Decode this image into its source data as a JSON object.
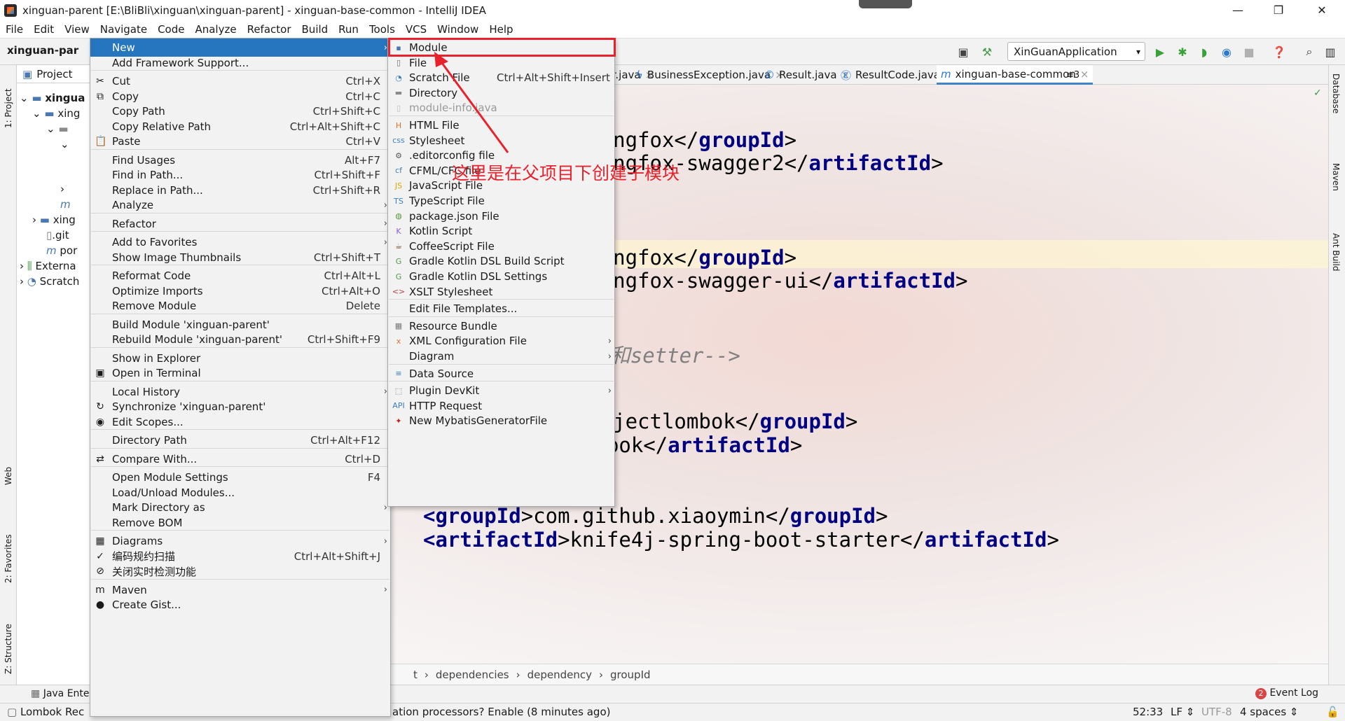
{
  "window": {
    "title": "xinguan-parent [E:\\BliBli\\xinguan\\xinguan-parent] - xinguan-base-common - IntelliJ IDEA",
    "minimize": "—",
    "maximize": "❐",
    "close": "✕"
  },
  "menubar": [
    "File",
    "Edit",
    "View",
    "Navigate",
    "Code",
    "Analyze",
    "Refactor",
    "Build",
    "Run",
    "Tools",
    "VCS",
    "Window",
    "Help"
  ],
  "toolbar": {
    "breadcrumb": "xinguan-par",
    "run_config": "XinGuanApplication"
  },
  "left_tabs": [
    "1: Project",
    "Web",
    "2: Favorites",
    "Z: Structure"
  ],
  "right_tabs": [
    "Database",
    "Maven",
    "Ant Build"
  ],
  "project_panel": {
    "header": "Project",
    "rows": [
      "xingua",
      "xing",
      "",
      "",
      "",
      "m",
      "xing",
      ".git",
      "por",
      "Externa",
      "Scratch"
    ]
  },
  "editor": {
    "tabs": [
      "balExceptionHandler.java",
      "BusinessException.java",
      "Result.java",
      "ResultCode.java",
      "xinguan-base-common"
    ],
    "tab_overflow": "≡3",
    "code_lines": [
      {
        "pre": "-->",
        "tag": "",
        "mid": "",
        "tag2": "",
        "post": "",
        "comment": true
      },
      {
        "pre": ">",
        "tag": "",
        "mid": "",
        "tag2": "",
        "post": ""
      },
      {
        "pre": "d>",
        "tag": "",
        "mid": "io.springfox</",
        "tag2": "groupId",
        "post": ">"
      },
      {
        "pre": "ct",
        "tag": "Id",
        "mid": ">springfox-swagger2</",
        "tag2": "artifactId",
        "post": ">"
      },
      {
        "pre": "/>",
        "tag": "",
        "mid": "",
        "tag2": "",
        "post": ""
      },
      {
        "pre": ">",
        "tag": "",
        "mid": "",
        "tag2": "",
        "post": ""
      },
      {
        "pre": "d>",
        "tag": "",
        "mid": "io.springfox</",
        "tag2": "groupId",
        "post": ">"
      },
      {
        "pre": "ct",
        "tag": "Id",
        "mid": ">springfox-swagger-ui</",
        "tag2": "artifactId",
        "post": ">"
      },
      {
        "pre": "/>",
        "tag": "",
        "mid": "",
        "tag2": "",
        "post": ""
      },
      {
        "pre": "简化getter和setter-->",
        "tag": "",
        "mid": "",
        "tag2": "",
        "post": "",
        "comment": true
      },
      {
        "pre": ">",
        "tag": "",
        "mid": "",
        "tag2": "",
        "post": ""
      },
      {
        "pre": "d>",
        "tag": "",
        "mid": "org.projectlombok</",
        "tag2": "groupId",
        "post": ">"
      },
      {
        "pre": "<",
        "tag": "artifactId",
        "mid": ">lombok</",
        "tag2": "artifactId",
        "post": ">"
      },
      {
        "pre": "</",
        "tag": "dependency",
        "mid": "",
        "tag2": "",
        "post": ">"
      },
      {
        "pre": "<",
        "tag": "dependency",
        "mid": "",
        "tag2": "",
        "post": ">"
      },
      {
        "pre": "<",
        "tag": "groupId",
        "mid": ">com.github.xiaoymin</",
        "tag2": "groupId",
        "post": ">"
      },
      {
        "pre": "<",
        "tag": "artifactId",
        "mid": ">knife4j-spring-boot-starter</",
        "tag2": "artifactId",
        "post": ">"
      }
    ],
    "breadcrumbs": [
      "t",
      "dependencies",
      "dependency",
      "groupId"
    ]
  },
  "context_menu": {
    "items": [
      {
        "label": "New",
        "shortcut": "",
        "submenu": true,
        "selected": true,
        "icon": ""
      },
      {
        "label": "Add Framework Support...",
        "shortcut": "",
        "icon": ""
      },
      {
        "label": "Cut",
        "shortcut": "Ctrl+X",
        "icon": "✂",
        "sep_before": true
      },
      {
        "label": "Copy",
        "shortcut": "Ctrl+C",
        "icon": "⧉"
      },
      {
        "label": "Copy Path",
        "shortcut": "Ctrl+Shift+C",
        "icon": ""
      },
      {
        "label": "Copy Relative Path",
        "shortcut": "Ctrl+Alt+Shift+C",
        "icon": ""
      },
      {
        "label": "Paste",
        "shortcut": "Ctrl+V",
        "icon": "📋"
      },
      {
        "label": "Find Usages",
        "shortcut": "Alt+F7",
        "icon": "",
        "sep_before": true
      },
      {
        "label": "Find in Path...",
        "shortcut": "Ctrl+Shift+F",
        "icon": ""
      },
      {
        "label": "Replace in Path...",
        "shortcut": "Ctrl+Shift+R",
        "icon": ""
      },
      {
        "label": "Analyze",
        "shortcut": "",
        "submenu": true,
        "icon": ""
      },
      {
        "label": "Refactor",
        "shortcut": "",
        "submenu": true,
        "icon": "",
        "sep_before": true
      },
      {
        "label": "Add to Favorites",
        "shortcut": "",
        "submenu": true,
        "icon": "",
        "sep_before": true
      },
      {
        "label": "Show Image Thumbnails",
        "shortcut": "Ctrl+Shift+T",
        "icon": ""
      },
      {
        "label": "Reformat Code",
        "shortcut": "Ctrl+Alt+L",
        "icon": "",
        "sep_before": true
      },
      {
        "label": "Optimize Imports",
        "shortcut": "Ctrl+Alt+O",
        "icon": ""
      },
      {
        "label": "Remove Module",
        "shortcut": "Delete",
        "icon": ""
      },
      {
        "label": "Build Module 'xinguan-parent'",
        "shortcut": "",
        "icon": "",
        "sep_before": true
      },
      {
        "label": "Rebuild Module 'xinguan-parent'",
        "shortcut": "Ctrl+Shift+F9",
        "icon": ""
      },
      {
        "label": "Show in Explorer",
        "shortcut": "",
        "icon": "",
        "sep_before": true
      },
      {
        "label": "Open in Terminal",
        "shortcut": "",
        "icon": "▣"
      },
      {
        "label": "Local History",
        "shortcut": "",
        "submenu": true,
        "icon": "",
        "sep_before": true
      },
      {
        "label": "Synchronize 'xinguan-parent'",
        "shortcut": "",
        "icon": "↻"
      },
      {
        "label": "Edit Scopes...",
        "shortcut": "",
        "icon": "◉"
      },
      {
        "label": "Directory Path",
        "shortcut": "Ctrl+Alt+F12",
        "icon": "",
        "sep_before": true
      },
      {
        "label": "Compare With...",
        "shortcut": "Ctrl+D",
        "icon": "⇄",
        "sep_before": true
      },
      {
        "label": "Open Module Settings",
        "shortcut": "F4",
        "icon": "",
        "sep_before": true
      },
      {
        "label": "Load/Unload Modules...",
        "shortcut": "",
        "icon": ""
      },
      {
        "label": "Mark Directory as",
        "shortcut": "",
        "submenu": true,
        "icon": ""
      },
      {
        "label": "Remove BOM",
        "shortcut": "",
        "icon": ""
      },
      {
        "label": "Diagrams",
        "shortcut": "",
        "submenu": true,
        "icon": "▦",
        "sep_before": true
      },
      {
        "label": "编码规约扫描",
        "shortcut": "Ctrl+Alt+Shift+J",
        "icon": "✓"
      },
      {
        "label": "关闭实时检测功能",
        "shortcut": "",
        "icon": "⊘"
      },
      {
        "label": "Maven",
        "shortcut": "",
        "submenu": true,
        "icon": "m",
        "sep_before": true
      },
      {
        "label": "Create Gist...",
        "shortcut": "",
        "icon": "●"
      }
    ]
  },
  "new_submenu": {
    "items": [
      {
        "label": "Module",
        "shortcut": "",
        "icon": "▪",
        "color": "#4a78b0"
      },
      {
        "label": "File",
        "shortcut": "",
        "icon": "▯",
        "color": "#6b6b6b"
      },
      {
        "label": "Scratch File",
        "shortcut": "Ctrl+Alt+Shift+Insert",
        "icon": "◔",
        "color": "#3d7fc4"
      },
      {
        "label": "Directory",
        "shortcut": "",
        "icon": "▬",
        "color": "#8a8a8a"
      },
      {
        "label": "module-info.java",
        "shortcut": "",
        "icon": "▯",
        "color": "#bbbbbb",
        "disabled": true
      },
      {
        "label": "HTML File",
        "shortcut": "",
        "icon": "H",
        "color": "#e0702b",
        "sep_before": true
      },
      {
        "label": "Stylesheet",
        "shortcut": "",
        "icon": "css",
        "color": "#3d7fc4"
      },
      {
        "label": ".editorconfig file",
        "shortcut": "",
        "icon": "⚙",
        "color": "#555555"
      },
      {
        "label": "CFML/CFC file",
        "shortcut": "",
        "icon": "cf",
        "color": "#3d7fc4"
      },
      {
        "label": "JavaScript File",
        "shortcut": "",
        "icon": "JS",
        "color": "#d9a400"
      },
      {
        "label": "TypeScript File",
        "shortcut": "",
        "icon": "TS",
        "color": "#3d7fc4"
      },
      {
        "label": "package.json File",
        "shortcut": "",
        "icon": "◍",
        "color": "#5a9a3a"
      },
      {
        "label": "Kotlin Script",
        "shortcut": "",
        "icon": "K",
        "color": "#8a5cd0"
      },
      {
        "label": "CoffeeScript File",
        "shortcut": "",
        "icon": "☕",
        "color": "#6b4a2a"
      },
      {
        "label": "Gradle Kotlin DSL Build Script",
        "shortcut": "",
        "icon": "G",
        "color": "#4a9a4a"
      },
      {
        "label": "Gradle Kotlin DSL Settings",
        "shortcut": "",
        "icon": "G",
        "color": "#4a9a4a"
      },
      {
        "label": "XSLT Stylesheet",
        "shortcut": "",
        "icon": "<>",
        "color": "#c04040"
      },
      {
        "label": "Edit File Templates...",
        "shortcut": "",
        "icon": "",
        "color": "#000000",
        "sep_before": true
      },
      {
        "label": "Resource Bundle",
        "shortcut": "",
        "icon": "▦",
        "color": "#7a7a7a",
        "sep_before": true
      },
      {
        "label": "XML Configuration File",
        "shortcut": "",
        "icon": "x",
        "color": "#e0702b",
        "submenu": true
      },
      {
        "label": "Diagram",
        "shortcut": "",
        "icon": "",
        "color": "#000000",
        "submenu": true
      },
      {
        "label": "Data Source",
        "shortcut": "",
        "icon": "≡",
        "color": "#3d7fc4",
        "sep_before": true
      },
      {
        "label": "Plugin DevKit",
        "shortcut": "",
        "icon": "⬚",
        "color": "#7a7a7a",
        "submenu": true,
        "sep_before": true
      },
      {
        "label": "HTTP Request",
        "shortcut": "",
        "icon": "API",
        "color": "#3d7fc4"
      },
      {
        "label": "New MybatisGeneratorFile",
        "shortcut": "",
        "icon": "✦",
        "color": "#c02020"
      }
    ]
  },
  "annotation": {
    "text": "这里是在父项目下创建子模块",
    "color": "#e8222c"
  },
  "bottom_tools": {
    "java_enterprise": "Java Ente",
    "event_log": "Event Log",
    "event_count": "2"
  },
  "statusbar": {
    "lombok": "Lombok Rec",
    "message": "ation processors? Enable (8 minutes ago)",
    "position": "52:33",
    "line_sep": "LF ⇕",
    "encoding": "UTF-8",
    "indent": "4 spaces ⇕"
  }
}
